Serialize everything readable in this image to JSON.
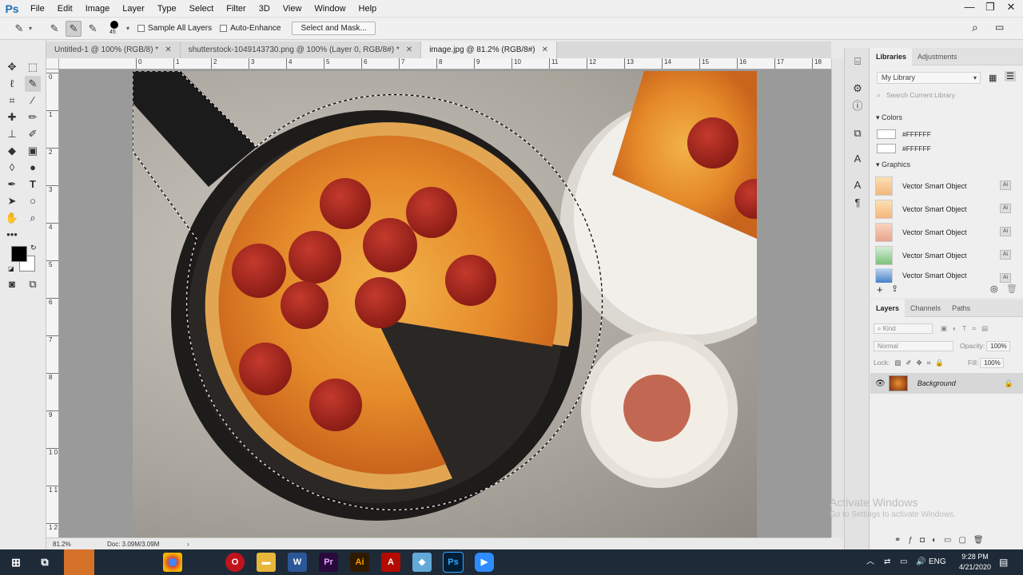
{
  "app": {
    "logo": "Ps"
  },
  "menu": [
    "File",
    "Edit",
    "Image",
    "Layer",
    "Type",
    "Select",
    "Filter",
    "3D",
    "View",
    "Window",
    "Help"
  ],
  "window_controls": {
    "minimize": "—",
    "restore": "❐",
    "close": "✕"
  },
  "options": {
    "brush_size": "45",
    "sample_all_layers": "Sample All Layers",
    "auto_enhance": "Auto-Enhance",
    "select_and_mask": "Select and Mask..."
  },
  "tabs": [
    {
      "label": "Untitled-1 @ 100% (RGB/8) *",
      "active": false
    },
    {
      "label": "shutterstock-1049143730.png @ 100% (Layer 0, RGB/8#) *",
      "active": false
    },
    {
      "label": "image.jpg @ 81.2% (RGB/8#)",
      "active": true
    }
  ],
  "ruler_h": [
    "0",
    "1",
    "2",
    "3",
    "4",
    "5",
    "6",
    "7",
    "8",
    "9",
    "10",
    "11",
    "12",
    "13",
    "14",
    "15",
    "16",
    "17",
    "18"
  ],
  "ruler_v": [
    "0",
    "1",
    "2",
    "3",
    "4",
    "5",
    "6",
    "7",
    "8",
    "9",
    "1 0",
    "1 1",
    "1 2"
  ],
  "status": {
    "zoom": "81.2%",
    "doc": "Doc: 3.09M/3.09M"
  },
  "libraries": {
    "tabs": [
      "Libraries",
      "Adjustments"
    ],
    "library": "My Library",
    "search_placeholder": "Search Current Library",
    "colors_heading": "Colors",
    "colors": [
      "#FFFFFF",
      "#FFFFFF"
    ],
    "graphics_heading": "Graphics",
    "graphics": [
      "Vector Smart Object",
      "Vector Smart Object",
      "Vector Smart Object",
      "Vector Smart Object",
      "Vector Smart Object"
    ],
    "ai_badge": "Ai"
  },
  "layers": {
    "tabs": [
      "Layers",
      "Channels",
      "Paths"
    ],
    "kind": "Kind",
    "blend_mode": "Normal",
    "opacity_label": "Opacity:",
    "opacity": "100%",
    "lock_label": "Lock:",
    "fill_label": "Fill:",
    "fill": "100%",
    "layer_name": "Background"
  },
  "watermark": {
    "title": "Activate Windows",
    "subtitle": "Go to Settings to activate Windows."
  },
  "taskbar": {
    "apps": [
      "Chrome",
      "Opera",
      "Explorer",
      "Word",
      "Premiere",
      "Illustrator",
      "Acrobat",
      "Store",
      "Photoshop",
      "Zoom"
    ],
    "icon_labels": {
      "word": "W",
      "premiere": "Pr",
      "illustrator": "Ai",
      "photoshop": "Ps"
    },
    "lang": "ENG",
    "time": "9:28 PM",
    "date": "4/21/2020"
  }
}
